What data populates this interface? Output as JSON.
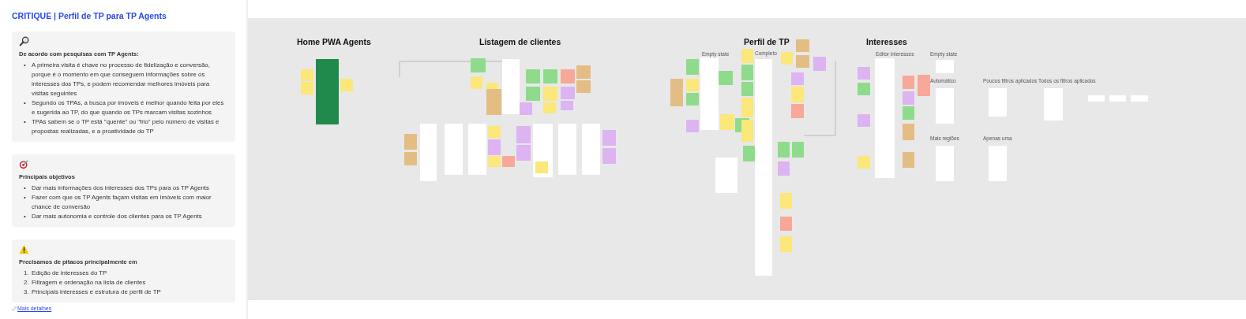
{
  "panel": {
    "title": "CRITIQUE | Perfil de TP para TP Agents",
    "cards": [
      {
        "kind": "research",
        "heading": "De acordo com pesquisas com TP Agents:",
        "items": [
          {
            "marker": "•",
            "text": "A primeira visita é chave no processo de fidelização e conversão, porque é o momento em que conseguem informações sobre os interesses dos TPs, e podem recomendar melhores imóveis para visitas seguintes"
          },
          {
            "marker": "•",
            "text": "Segundo os TPAs, a busca por imóveis é melhor quando feita por eles e sugerida ao TP, do que quando os TPs marcam visitas sozinhos"
          },
          {
            "marker": "•",
            "text": "TPAs sabem se o TP está \"quente\" ou \"frio\" pelo número de visitas e propostas realizadas, e a proatividade do TP"
          }
        ]
      },
      {
        "kind": "goals",
        "heading": "Principais objetivos",
        "items": [
          {
            "marker": "•",
            "text": "Dar mais informações dos interesses dos TPs para os TP Agents"
          },
          {
            "marker": "•",
            "text": "Fazer com que os TP Agents façam visitas em imóveis com maior chance de conversão"
          },
          {
            "marker": "•",
            "text": "Dar mais autonomia e controle dos clientes para os TP Agents"
          }
        ]
      },
      {
        "kind": "warning",
        "heading": "Precisamos de pitacos principalmente em",
        "items": [
          {
            "marker": "1.",
            "text": "Edição de interesses do TP"
          },
          {
            "marker": "2.",
            "text": "Filtragem e ordenação na lista de clientes"
          },
          {
            "marker": "3.",
            "text": "Principais interesses e estrutura de perfil de TP"
          }
        ]
      }
    ],
    "link": "Mais detalhes"
  },
  "board": {
    "headings": [
      "Home PWA Agents",
      "Listagem de clientes",
      "Perfil de TP",
      "Interesses"
    ],
    "labels": [
      "Empty state",
      "Completo",
      "Editor interesses",
      "Empty state",
      "Automático",
      "Poucos filtros aplicados",
      "Todos os filtros aplicados",
      "Mais regiões",
      "Apenas uma"
    ]
  }
}
